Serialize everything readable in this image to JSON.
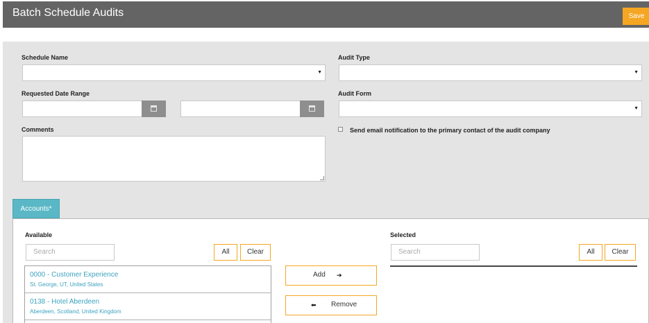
{
  "header": {
    "title": "Batch Schedule Audits",
    "save_label": "Save"
  },
  "form": {
    "schedule_name_label": "Schedule Name",
    "audit_type_label": "Audit Type",
    "requested_date_range_label": "Requested Date Range",
    "audit_form_label": "Audit Form",
    "comments_label": "Comments",
    "email_notification_label": "Send email notification to the primary contact of the audit company",
    "caret": "▼"
  },
  "tabs": [
    {
      "label": "Accounts*"
    }
  ],
  "accounts": {
    "available_label": "Available",
    "selected_label": "Selected",
    "search_placeholder": "Search",
    "all_label": "All",
    "clear_label": "Clear",
    "add_label": "Add",
    "remove_label": "Remove",
    "add_arrow": "➔",
    "remove_arrow": "⬅",
    "items": [
      {
        "name": "0000 - Customer Experience",
        "location": "St. George, UT, United States"
      },
      {
        "name": "0138 - Hotel Aberdeen",
        "location": "Aberdeen, Scotland, United Kingdom"
      }
    ]
  },
  "colors": {
    "accent": "#f5a623",
    "tab": "#5ab8c6",
    "link": "#3ca3c0",
    "header_bg": "#646464"
  }
}
